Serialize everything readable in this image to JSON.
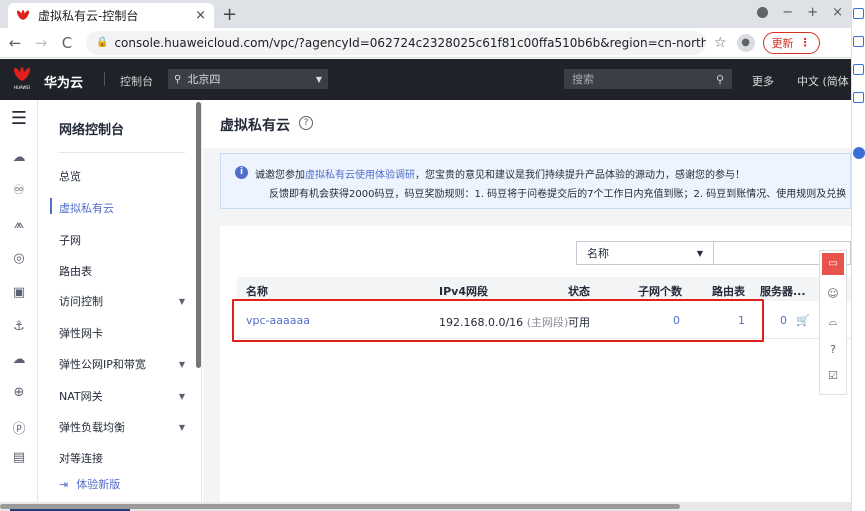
{
  "browser": {
    "tab_title": "虚拟私有云-控制台",
    "tab_close": "×",
    "new_tab": "+",
    "url": "console.huaweicloud.com/vpc/?agencyId=062724c2328025c61f81c00ffa510b6b&region=cn-north-4&locale=zh-···",
    "update_label": "更新",
    "window_controls": [
      "−",
      "+",
      "×"
    ]
  },
  "topbar": {
    "brand": "华为云",
    "logo_text": "HUAWEI",
    "console": "控制台",
    "region": "北京四",
    "search_placeholder": "搜索",
    "more": "更多",
    "language": "中文 (简体"
  },
  "nav": {
    "title": "网络控制台",
    "items": [
      {
        "label": "总览"
      },
      {
        "label": "虚拟私有云"
      },
      {
        "label": "子网"
      },
      {
        "label": "路由表"
      },
      {
        "label": "访问控制"
      },
      {
        "label": "弹性网卡"
      },
      {
        "label": "弹性公网IP和带宽"
      },
      {
        "label": "NAT网关"
      },
      {
        "label": "弹性负载均衡"
      },
      {
        "label": "对等连接"
      },
      {
        "label": "体验新版"
      }
    ],
    "active_index": 1
  },
  "main": {
    "title": "虚拟私有云",
    "notice": {
      "line1_prefix": "诚邀您参加",
      "line1_link": "虚拟私有云使用体验调研",
      "line1_suffix": "，您宝贵的意见和建议是我们持续提升产品体验的源动力，感谢您的参与！",
      "line2": "反馈即有机会获得2000码豆，码豆奖励规则：1. 码豆将于问卷提交后的7个工作日内充值到账；2. 码豆到账情况、使用规则及兑换"
    },
    "filter_label": "名称",
    "table": {
      "columns": [
        "名称",
        "IPv4网段",
        "状态",
        "子网个数",
        "路由表",
        "服务器..."
      ],
      "rows": [
        {
          "name": "vpc-aaaaaa",
          "cidr": "192.168.0.0/16",
          "cidr_note": "(主网段)",
          "status": "可用",
          "subnets": "0",
          "route_tables": "1",
          "servers": "0"
        }
      ]
    }
  },
  "colors": {
    "accent": "#526ecc",
    "topbar_bg": "#1f2329",
    "highlight_box": "#e0201c"
  }
}
